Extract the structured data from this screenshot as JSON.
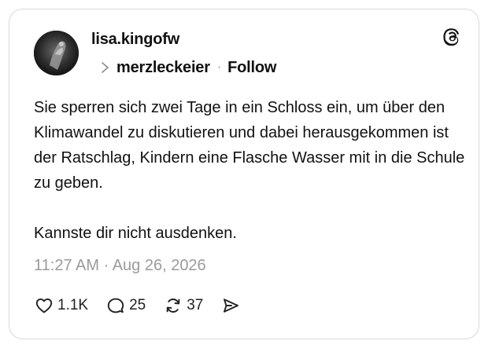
{
  "post": {
    "author": "lisa.kingofw",
    "reply_to_user": "merzleckeier",
    "separator": "·",
    "follow_label": "Follow",
    "text_paragraphs": [
      "Sie sperren sich zwei Tage in ein Schloss ein, um über den Klimawandel zu diskutieren und dabei herausgekommen ist der Ratschlag, Kindern eine Flasche Wasser mit in die Schule zu geben.",
      "Kannste dir nicht ausdenken."
    ],
    "timestamp": "11:27 AM · Aug 26, 2026"
  },
  "actions": {
    "likes": "1.1K",
    "replies": "25",
    "reposts": "37"
  },
  "icons": {
    "brand": "threads-logo-icon",
    "reply_indicator": "chevron-right-icon",
    "like": "heart-icon",
    "reply": "comment-bubble-icon",
    "repost": "repost-icon",
    "share": "send-icon"
  },
  "colors": {
    "text": "#111111",
    "muted": "#9b9b9b",
    "border": "#d9d9d9",
    "background": "#ffffff"
  }
}
